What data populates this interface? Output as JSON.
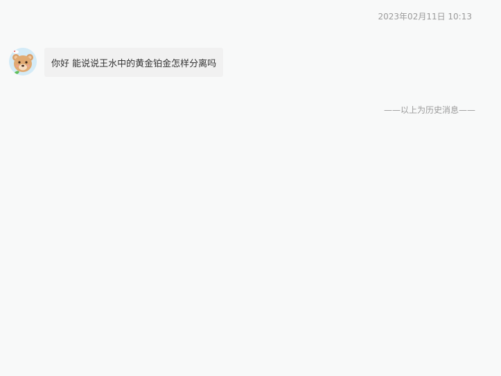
{
  "chat": {
    "timestamp": "2023年02月11日 10:13",
    "messages": [
      {
        "avatar_icon": "bear-avatar-icon",
        "text": "你好 能说说王水中的黄金铂金怎样分离吗"
      }
    ],
    "history_divider": "——以上为历史消息——"
  }
}
